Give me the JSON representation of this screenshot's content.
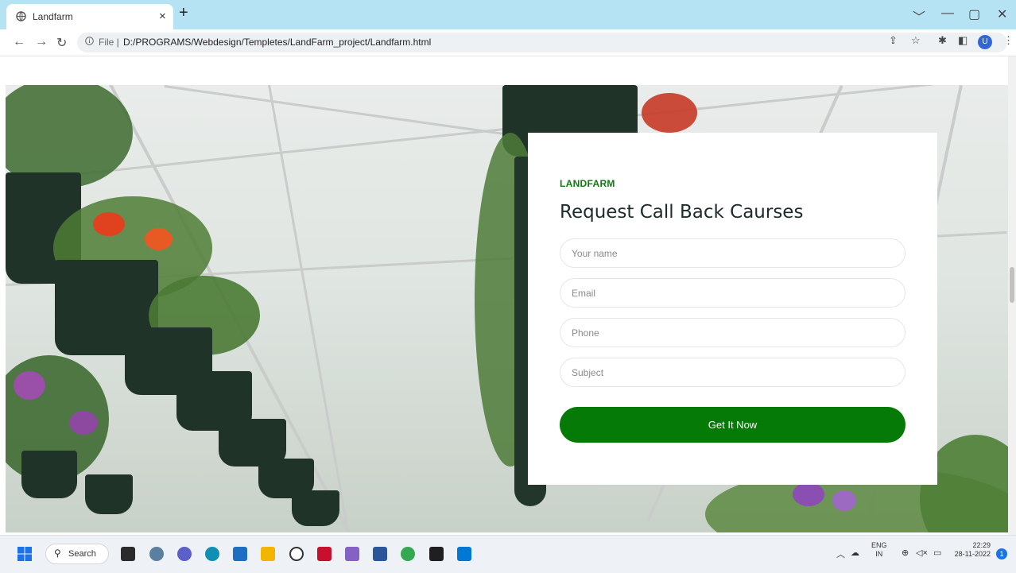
{
  "browser": {
    "tab_title": "Landfarm",
    "tab_close": "×",
    "new_tab": "+",
    "file_label": "File |",
    "url": "D:/PROGRAMS/Webdesign/Templetes/LandFarm_project/Landfarm.html",
    "profile_initial": "U",
    "window_buttons": [
      "﹀",
      "—",
      "▢",
      "✕"
    ]
  },
  "form": {
    "brand": "LANDFARM",
    "heading": "Request Call Back Caurses",
    "name_placeholder": "Your name",
    "email_placeholder": "Email",
    "phone_placeholder": "Phone",
    "subject_placeholder": "Subject",
    "submit_label": "Get It Now"
  },
  "taskbar": {
    "search_label": "Search",
    "lang_top": "ENG",
    "lang_bottom": "IN",
    "time": "22:29",
    "date": "28-11-2022",
    "notification_count": "1"
  },
  "colors": {
    "accent_green": "#067a06",
    "tabbar": "#b6e3f3"
  }
}
